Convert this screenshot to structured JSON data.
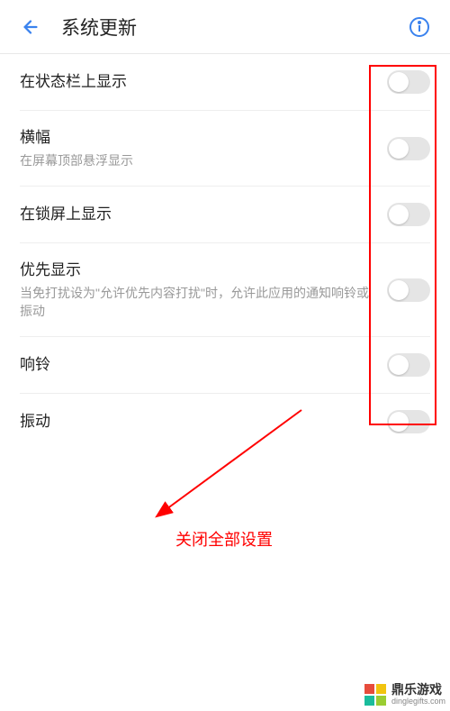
{
  "header": {
    "title": "系统更新"
  },
  "settings": [
    {
      "label": "在状态栏上显示",
      "sublabel": "",
      "on": false
    },
    {
      "label": "横幅",
      "sublabel": "在屏幕顶部悬浮显示",
      "on": false
    },
    {
      "label": "在锁屏上显示",
      "sublabel": "",
      "on": false
    },
    {
      "label": "优先显示",
      "sublabel": "当免打扰设为\"允许优先内容打扰\"时，允许此应用的通知响铃或振动",
      "on": false
    },
    {
      "label": "响铃",
      "sublabel": "",
      "on": false
    },
    {
      "label": "振动",
      "sublabel": "",
      "on": false
    }
  ],
  "annotation": {
    "text": "关闭全部设置",
    "color": "#ff0000"
  },
  "watermark": {
    "brand": "鼎乐游戏",
    "url": "dinglegifts.com"
  }
}
